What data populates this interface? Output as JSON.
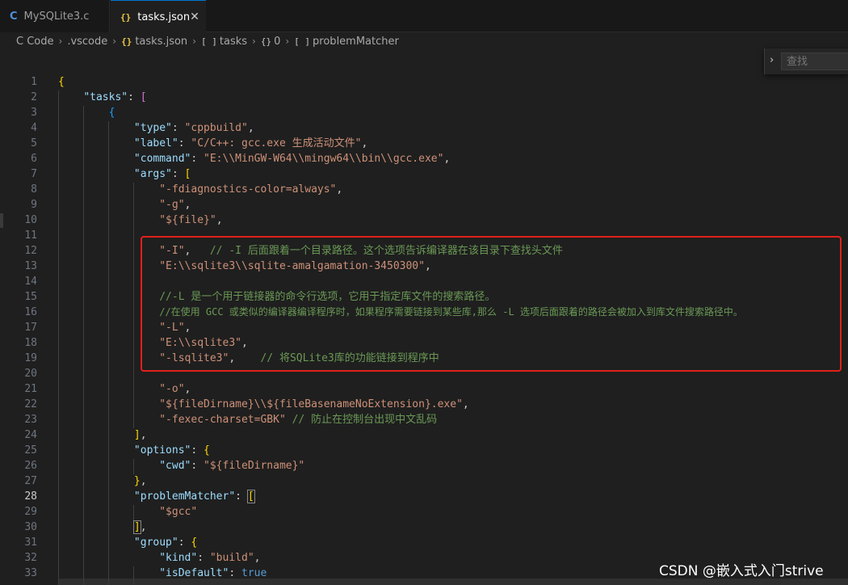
{
  "tabs": [
    {
      "icon": "C",
      "label": "MySQLite3.c"
    },
    {
      "icon": "{}",
      "label": "tasks.json",
      "close": "✕"
    }
  ],
  "breadcrumb": [
    {
      "icon": "",
      "label": "C Code"
    },
    {
      "icon": "",
      "label": ".vscode"
    },
    {
      "icon": "{}",
      "label": "tasks.json"
    },
    {
      "icon": "[ ]",
      "label": "tasks"
    },
    {
      "icon": "{}",
      "label": "0"
    },
    {
      "icon": "[ ]",
      "label": "problemMatcher"
    }
  ],
  "find": {
    "chevron": "›",
    "placeholder": "查找"
  },
  "editor": {
    "line_numbers": [
      "1",
      "2",
      "3",
      "4",
      "5",
      "6",
      "7",
      "8",
      "9",
      "10",
      "11",
      "12",
      "13",
      "14",
      "15",
      "16",
      "17",
      "18",
      "19",
      "20",
      "21",
      "22",
      "23",
      "24",
      "25",
      "26",
      "27",
      "28",
      "29",
      "30",
      "31",
      "32",
      "33"
    ],
    "active_line": "28",
    "text": {
      "tasks_key": "\"tasks\"",
      "type_key": "\"type\"",
      "type_val": "\"cppbuild\"",
      "label_key": "\"label\"",
      "label_val": "\"C/C++: gcc.exe 生成活动文件\"",
      "command_key": "\"command\"",
      "command_val": "\"E:\\\\MinGW-W64\\\\mingw64\\\\bin\\\\gcc.exe\"",
      "args_key": "\"args\"",
      "arg1": "\"-fdiagnostics-color=always\"",
      "arg2": "\"-g\"",
      "arg3": "\"${file}\"",
      "arg_I": "\"-I\"",
      "comment_I": "// -I 后面跟着一个目录路径。这个选项告诉编译器在该目录下查找头文件",
      "arg_inc_path": "\"E:\\\\sqlite3\\\\sqlite-amalgamation-3450300\"",
      "comment_L1": "//-L 是一个用于链接器的命令行选项，它用于指定库文件的搜索路径。",
      "comment_L2": "//在使用 GCC 或类似的编译器编译程序时，如果程序需要链接到某些库,那么 -L 选项后面跟着的路径会被加入到库文件搜索路径中。",
      "arg_L": "\"-L\"",
      "arg_lib_path": "\"E:\\\\sqlite3\"",
      "arg_lsqlite3": "\"-lsqlite3\"",
      "comment_lsqlite3": "// 将SQLite3库的功能链接到程序中",
      "arg_o": "\"-o\"",
      "arg_out": "\"${fileDirname}\\\\${fileBasenameNoExtension}.exe\"",
      "arg_charset": "\"-fexec-charset=GBK\"",
      "comment_charset": "// 防止在控制台出现中文乱码",
      "options_key": "\"options\"",
      "cwd_key": "\"cwd\"",
      "cwd_val": "\"${fileDirname}\"",
      "problemMatcher_key": "\"problemMatcher\"",
      "pm_val": "\"$gcc\"",
      "group_key": "\"group\"",
      "kind_key": "\"kind\"",
      "kind_val": "\"build\"",
      "isDefault_key": "\"isDefault\"",
      "isDefault_val": "true"
    }
  },
  "watermark": "CSDN @嵌入式入门strive",
  "colors": {
    "editor_bg": "#1f1f1f",
    "key": "#9cdcfe",
    "string": "#ce9178",
    "comment": "#6a9955",
    "bracket_gold": "#ffd700",
    "bracket_purple": "#da70d6",
    "bracket_blue": "#179fff",
    "highlight_box": "#e0201a",
    "tab_accent": "#0078d4"
  }
}
